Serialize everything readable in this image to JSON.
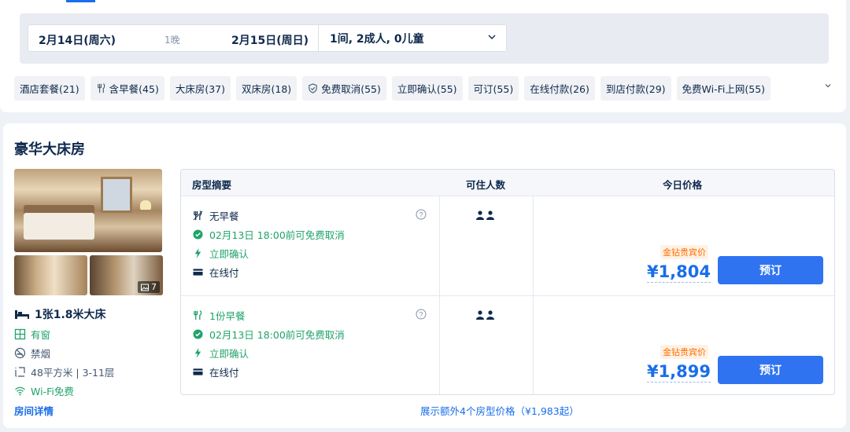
{
  "search": {
    "checkin": "2月14日(周六)",
    "nights": "1晚",
    "checkout": "2月15日(周日)",
    "guests": "1间, 2成人, 0儿童"
  },
  "filters": [
    {
      "label": "酒店套餐(21)",
      "icon": ""
    },
    {
      "label": "含早餐(45)",
      "icon": "fork-knife-icon"
    },
    {
      "label": "大床房(37)",
      "icon": ""
    },
    {
      "label": "双床房(18)",
      "icon": ""
    },
    {
      "label": "免费取消(55)",
      "icon": "shield-check-icon"
    },
    {
      "label": "立即确认(55)",
      "icon": ""
    },
    {
      "label": "可订(55)",
      "icon": ""
    },
    {
      "label": "在线付款(26)",
      "icon": ""
    },
    {
      "label": "到店付款(29)",
      "icon": ""
    },
    {
      "label": "免费Wi-Fi上网(55)",
      "icon": ""
    }
  ],
  "room": {
    "title": "豪华大床房",
    "photo_count": "7",
    "bed": "1张1.8米大床",
    "window": "有窗",
    "smoking": "禁烟",
    "size_floor": "48平方米 | 3-11层",
    "wifi": "Wi-Fi免费",
    "detail_link": "房间详情"
  },
  "table": {
    "headers": {
      "summary": "房型摘要",
      "occupancy": "可住人数",
      "price": "今日价格"
    },
    "rows": [
      {
        "meal": "无早餐",
        "cancel": "02月13日 18:00前可免费取消",
        "confirm": "立即确认",
        "payment": "在线付",
        "vip_tag": "金钻贵宾价",
        "price": "¥1,804",
        "book": "预订"
      },
      {
        "meal": "1份早餐",
        "cancel": "02月13日 18:00前可免费取消",
        "confirm": "立即确认",
        "payment": "在线付",
        "vip_tag": "金钻贵宾价",
        "price": "¥1,899",
        "book": "预订"
      }
    ]
  },
  "more_prices": "展示额外4个房型价格（¥1,983起）",
  "colors": {
    "accent": "#1a6ee9",
    "button": "#2f73f0",
    "green": "#1fa36a",
    "vip": "#ff6f00"
  }
}
